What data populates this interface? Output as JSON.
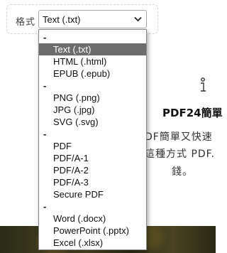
{
  "format": {
    "label": "格式",
    "selected": "Text (.txt)"
  },
  "dropdown": {
    "options": [
      {
        "text": "-",
        "sep": true
      },
      {
        "text": "Text (.txt)",
        "selected": true
      },
      {
        "text": "HTML (.html)"
      },
      {
        "text": "EPUB (.epub)"
      },
      {
        "text": "-",
        "sep": true
      },
      {
        "text": "PNG (.png)"
      },
      {
        "text": "JPG (.jpg)"
      },
      {
        "text": "SVG (.svg)"
      },
      {
        "text": "-",
        "sep": true
      },
      {
        "text": "PDF"
      },
      {
        "text": "PDF/A-1"
      },
      {
        "text": "PDF/A-2"
      },
      {
        "text": "PDF/A-3"
      },
      {
        "text": "Secure PDF"
      },
      {
        "text": "-",
        "sep": true
      },
      {
        "text": "Word (.docx)"
      },
      {
        "text": "PowerPoint (.pptx)"
      },
      {
        "text": "Excel (.xlsx)"
      }
    ]
  },
  "info": {
    "title": "PDF24簡單",
    "line1": "DF簡單又快速",
    "line2": "這種方式 PDF.",
    "line3": "錢。"
  },
  "icons": {
    "select_chevron": "chevron-down-icon",
    "info": "info-icon"
  }
}
